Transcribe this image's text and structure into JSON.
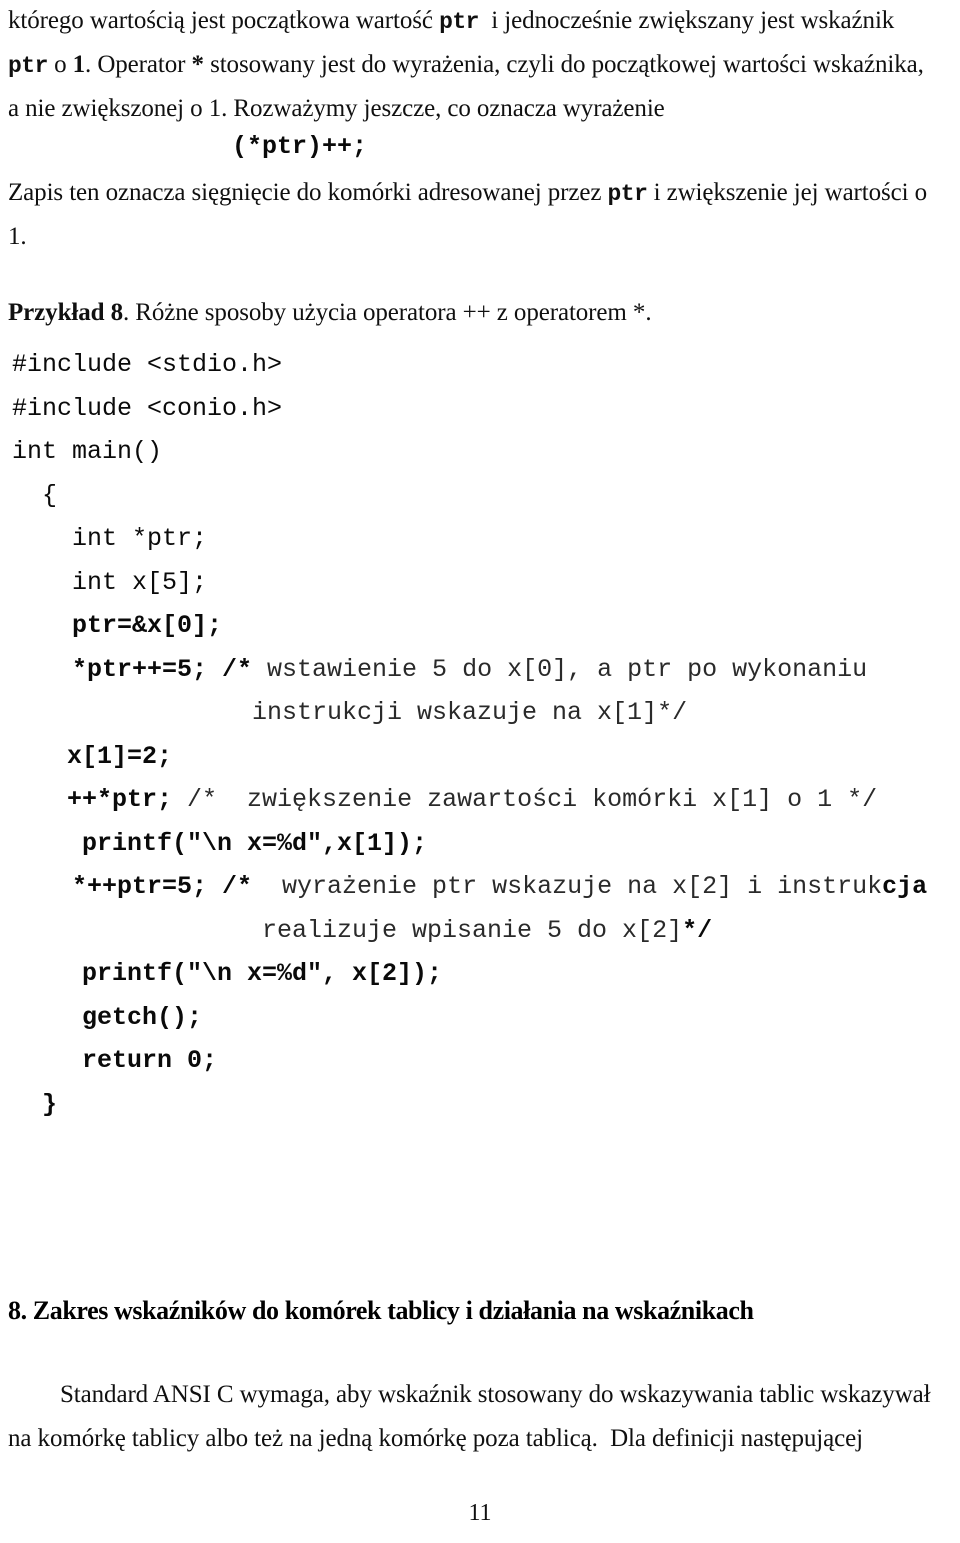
{
  "document": {
    "language": "pl",
    "page_number": "11"
  },
  "intro": {
    "line1_a": "którego wartością jest początkowa wartość ",
    "line1_mono": "ptr",
    "line1_b": "  i jednocześnie zwiększany jest wskaźnik",
    "line2_mono": "ptr",
    "line2_a": " o ",
    "line2_bold": "1",
    "line2_b": ". Operator ",
    "line2_star": "*",
    "line2_c": " stosowany jest do wyrażenia, czyli do początkowej wartości wskaźnika,",
    "line3": "a nie zwiększonej o 1. Rozważymy jeszcze, co oznacza wyrażenie",
    "expression": "(*ptr)++;",
    "line4_a": "Zapis ten oznacza sięgnięcie do komórki adresowanej przez ",
    "line4_mono": "ptr",
    "line4_b": " i zwiększenie jej wartości o",
    "line5": "1."
  },
  "example": {
    "label": "Przykład 8",
    "caption_a": ". Różne sposoby użycia operatora ",
    "caption_plus": "++",
    "caption_b": " z operatorem ",
    "caption_star": "*",
    "caption_c": "."
  },
  "code": {
    "lines": [
      {
        "indent": 0,
        "text": "#include <stdio.h>",
        "bold": false
      },
      {
        "indent": 0,
        "text": "#include <conio.h>",
        "bold": false
      },
      {
        "indent": 0,
        "text": "int main()",
        "bold": false
      },
      {
        "indent": 30,
        "text": "{",
        "bold": false
      },
      {
        "indent": 60,
        "text": "int *ptr;",
        "bold": false
      },
      {
        "indent": 60,
        "text": "int x[5];",
        "bold": false
      },
      {
        "indent": 60,
        "text": "ptr=&x[0];",
        "bold": true
      },
      {
        "indent": 60,
        "text": "*ptr++=5; /*",
        "bold": true,
        "comment": " wstawienie 5 do x[0], a ptr po wykonaniu"
      },
      {
        "indent": 240,
        "text": "",
        "bold": false,
        "comment": "instrukcji wskazuje na x[1]*/"
      },
      {
        "indent": 55,
        "text": "x[1]=2;",
        "bold": true
      },
      {
        "indent": 55,
        "text": "++*ptr;",
        "bold": true,
        "comment": " /*  zwiększenie zawartości komórki x[1] o 1 */"
      },
      {
        "indent": 70,
        "text": "printf(\"\\n x=%d\",x[1]);",
        "bold": true
      },
      {
        "indent": 60,
        "text": "*++ptr=5; /*",
        "bold": true,
        "comment": "  wyrażenie ptr wskazuje na x[2] i instruk",
        "comment_bold_tail": "cja"
      },
      {
        "indent": 250,
        "text": "",
        "bold": false,
        "comment": "realizuje wpisanie 5 do x[2]",
        "comment_bold_tail": "*/"
      },
      {
        "indent": 70,
        "text": "printf(\"\\n x=%d\", x[2]);",
        "bold": true
      },
      {
        "indent": 70,
        "text": "getch();",
        "bold": true
      },
      {
        "indent": 70,
        "text": "return 0;",
        "bold": true
      },
      {
        "indent": 30,
        "text": "}",
        "bold": true
      }
    ]
  },
  "section": {
    "heading": "8. Zakres wskaźników do komórek tablicy i działania na wskaźnikach",
    "para_line1": "Standard ANSI C wymaga, aby wskaźnik stosowany do wskazywania tablic wskazywał",
    "para_line2": "na komórkę tablicy albo też na jedną komórkę poza tablicą.  Dla definicji następującej"
  }
}
